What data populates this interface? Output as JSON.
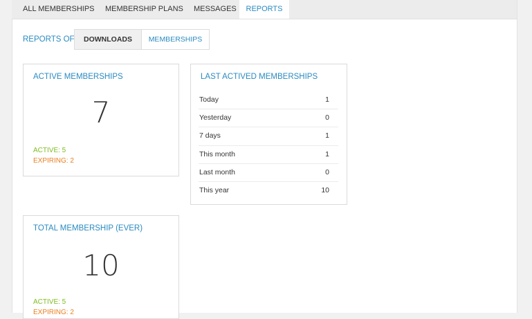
{
  "nav": {
    "tabs": [
      {
        "label": "ALL MEMBERSHIPS"
      },
      {
        "label": "MEMBERSHIP PLANS"
      },
      {
        "label": "MESSAGES"
      },
      {
        "label": "REPORTS",
        "active": true
      }
    ]
  },
  "reports": {
    "label": "REPORTS OF",
    "subtabs": [
      {
        "label": "DOWNLOADS"
      },
      {
        "label": "MEMBERSHIPS",
        "active": true
      }
    ]
  },
  "active_card": {
    "title": "ACTIVE MEMBERSHIPS",
    "count": "7",
    "active": "ACTIVE: 5",
    "expiring": "EXPIRING: 2"
  },
  "last_card": {
    "title": "LAST ACTIVED MEMBERSHIPS",
    "rows": [
      {
        "label": "Today",
        "value": "1"
      },
      {
        "label": "Yesterday",
        "value": "0"
      },
      {
        "label": "7 days",
        "value": "1"
      },
      {
        "label": "This month",
        "value": "1"
      },
      {
        "label": "Last month",
        "value": "0"
      },
      {
        "label": "This year",
        "value": "10"
      }
    ]
  },
  "total_card": {
    "title": "TOTAL MEMBERSHIP (EVER)",
    "count": "10",
    "active": "ACTIVE: 5",
    "expiring": "EXPIRING: 2"
  },
  "colors": {
    "accent": "#2a8bc1",
    "active_green": "#7dbd1f",
    "expiring_orange": "#e97f20"
  }
}
